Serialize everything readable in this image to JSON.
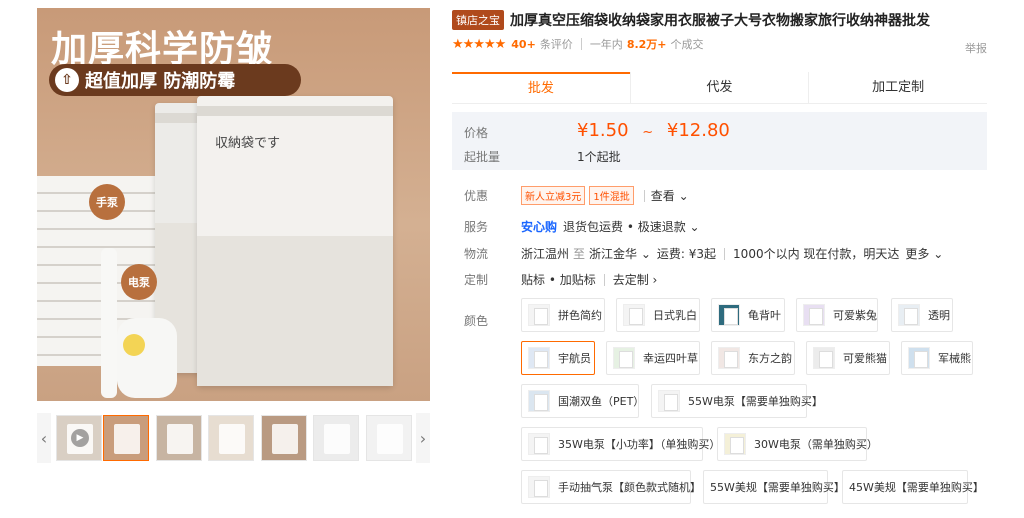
{
  "gallery": {
    "headline": "加厚科学防皱",
    "pill_text": "超值加厚 防潮防霉",
    "bag_label": "収納袋です",
    "tag_manual": "手泵",
    "tag_electric": "电泵",
    "prev_arrow": "‹",
    "next_arrow": "›",
    "thumb_count": 7
  },
  "product": {
    "badge": "镇店之宝",
    "title": "加厚真空压缩袋收纳袋家用衣服被子大号衣物搬家旅行收纳神器批发",
    "stars": "★★★★★",
    "review_count": "40+",
    "review_label": "条评价",
    "sales_prefix": "一年内",
    "sales_count": "8.2万+",
    "sales_suffix": "个成交",
    "report": "举报"
  },
  "tabs": [
    "批发",
    "代发",
    "加工定制"
  ],
  "price": {
    "label": "价格",
    "low": "¥1.50",
    "tilde": "~",
    "high": "¥12.80",
    "moq_label": "起批量",
    "moq_value": "1个起批"
  },
  "props": {
    "offer_label": "优惠",
    "offer_tag1": "新人立减3元",
    "offer_tag2": "1件混批",
    "offer_view": "查看 ⌄",
    "service_label": "服务",
    "service_brand": "安心购",
    "service_items": "退货包运费 • 极速退款 ⌄",
    "logistics_label": "物流",
    "logistics_from": "浙江温州",
    "logistics_to_word": "至",
    "logistics_to": "浙江金华 ⌄",
    "logistics_fee": "运费: ¥3起",
    "logistics_note": "1000个以内 现在付款，明天达",
    "logistics_more": "更多 ⌄",
    "custom_label": "定制",
    "custom_value": "贴标 • 加贴标",
    "custom_link": "去定制 ›",
    "color_label": "颜色"
  },
  "skus": [
    "拼色简约",
    "日式乳白",
    "龟背叶",
    "可爱紫兔",
    "透明",
    "宇航员",
    "幸运四叶草",
    "东方之韵",
    "可爱熊猫",
    "军械熊",
    "国潮双鱼（PET）",
    "55W电泵【需要单独购买】",
    "35W电泵【小功率】（单独购买）",
    "30W电泵（需单独购买）",
    "手动抽气泵【颜色款式随机】",
    "55W美规【需要单独购买】",
    "45W美规【需要单独购买】"
  ],
  "colors": {
    "accent": "#ff6a00",
    "price": "#ff5000",
    "badge": "#b04a1c"
  }
}
